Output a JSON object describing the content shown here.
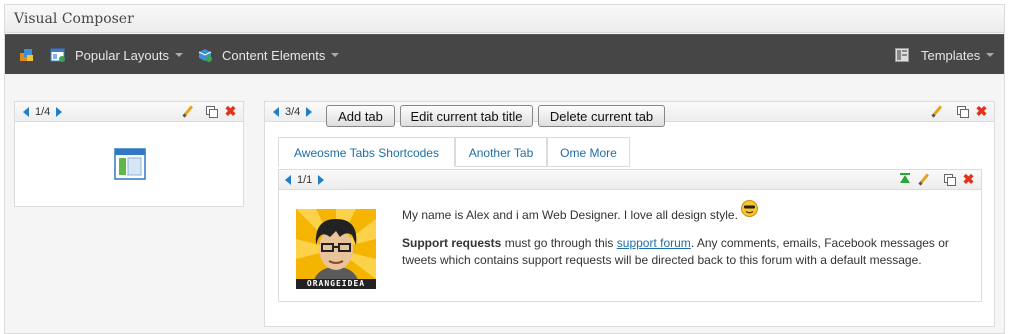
{
  "window": {
    "title": "Visual Composer"
  },
  "toolbar": {
    "popular_layouts": "Popular Layouts",
    "content_elements": "Content Elements",
    "templates": "Templates"
  },
  "left_panel": {
    "counter": "1/4"
  },
  "tabs_panel": {
    "counter": "3/4",
    "buttons": {
      "add": "Add tab",
      "edit": "Edit current tab title",
      "delete": "Delete current tab"
    },
    "tabs": [
      "Aweosme Tabs Shortcodes",
      "Another Tab",
      "Ome More"
    ]
  },
  "inner_panel": {
    "counter": "1/1",
    "avatar_caption": "ORANGEIDEA",
    "line1": "My name is Alex and i am Web Designer. I love all design style.",
    "support_bold": "Support requests",
    "support_pre": " must go through this ",
    "support_link": "support forum",
    "support_post": ". Any comments, emails, Facebook messages or tweets which contains support requests will be directed back to this forum with a default message."
  },
  "colors": {
    "toolbar_bg": "#464646",
    "link": "#1e6fa6",
    "accent_blue": "#1f7fc9",
    "delete_red": "#e1321e"
  },
  "icons": [
    "layouts-icon",
    "content-elements-icon",
    "templates-icon",
    "edit-pencil-icon",
    "clone-icon",
    "delete-icon",
    "move-up-icon",
    "prev-arrow-icon",
    "next-arrow-icon",
    "column-layout-icon",
    "smiley-icon"
  ]
}
